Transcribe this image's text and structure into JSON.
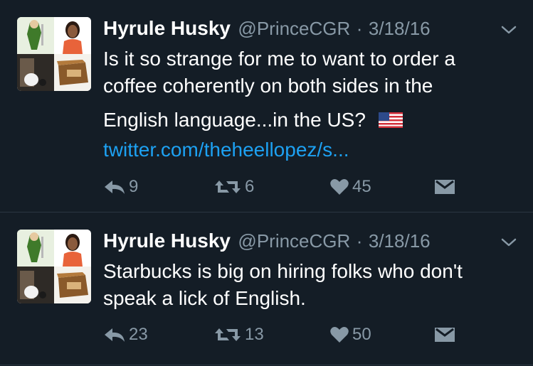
{
  "tweets": [
    {
      "display_name": "Hyrule Husky",
      "handle": "@PrinceCGR",
      "separator": "·",
      "date": "3/18/16",
      "text_line1": "Is it so strange for me to want to order a",
      "text_line2": "coffee coherently on both sides in the",
      "text_line3": "English language...in the US?",
      "link": "twitter.com/theheellopez/s...",
      "replies": "9",
      "retweets": "6",
      "likes": "45",
      "flag_icon": "us-flag-emoji"
    },
    {
      "display_name": "Hyrule Husky",
      "handle": "@PrinceCGR",
      "separator": "·",
      "date": "3/18/16",
      "text_line1": "Starbucks is big on hiring folks who don't",
      "text_line2": "speak a lick of English.",
      "replies": "23",
      "retweets": "13",
      "likes": "50"
    }
  ],
  "colors": {
    "background": "#141d26",
    "secondary_text": "#8899a6",
    "link": "#1da1f2",
    "divider": "#2a3642"
  }
}
